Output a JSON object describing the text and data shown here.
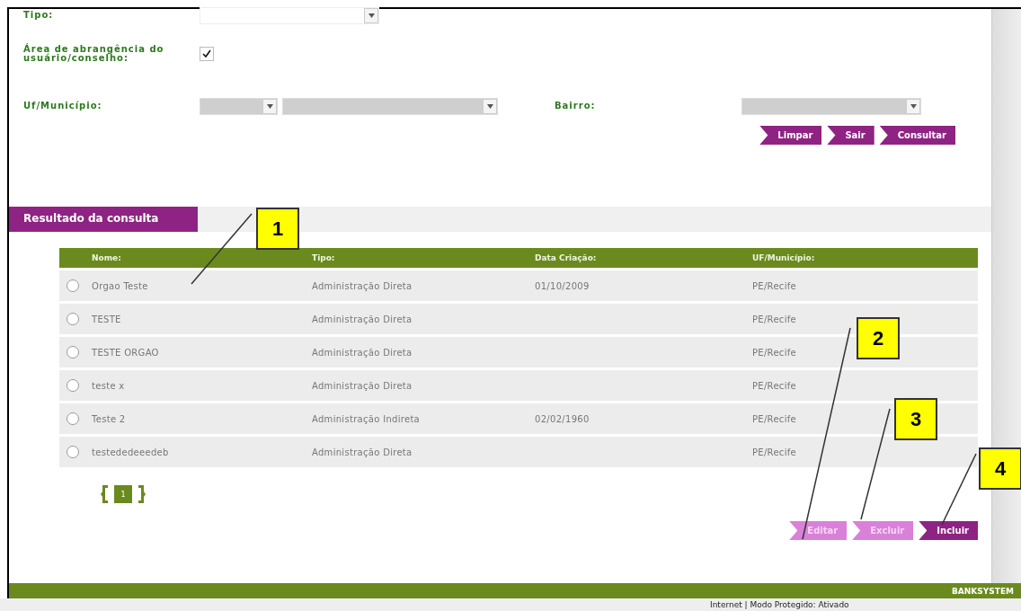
{
  "form": {
    "tipo": {
      "label": "Tipo:"
    },
    "area": {
      "label": "Área de abrangência do usuário/conselho:",
      "checked": true
    },
    "uf_municipio": {
      "label": "Uf/Município:"
    },
    "bairro": {
      "label": "Bairro:"
    },
    "buttons": [
      {
        "label": "Limpar",
        "disabled": false
      },
      {
        "label": "Sair",
        "disabled": false
      },
      {
        "label": "Consultar",
        "disabled": false
      }
    ]
  },
  "results": {
    "title": "Resultado da consulta",
    "columns": [
      "Nome:",
      "Tipo:",
      "Data Criação:",
      "UF/Município:"
    ],
    "rows": [
      {
        "selected": false,
        "cells": [
          "Orgao Teste",
          "Administração Direta",
          "01/10/2009",
          "PE/Recife"
        ]
      },
      {
        "selected": false,
        "cells": [
          "TESTE",
          "Administração Direta",
          "",
          "PE/Recife"
        ]
      },
      {
        "selected": false,
        "cells": [
          "TESTE ORGAO",
          "Administração Direta",
          "",
          "PE/Recife"
        ]
      },
      {
        "selected": false,
        "cells": [
          "teste x",
          "Administração Direta",
          "",
          "PE/Recife"
        ]
      },
      {
        "selected": false,
        "cells": [
          "Teste 2",
          "Administração Indireta",
          "02/02/1960",
          "PE/Recife"
        ]
      },
      {
        "selected": false,
        "cells": [
          "testededeeedeb",
          "Administração Direta",
          "",
          "PE/Recife"
        ]
      }
    ],
    "pages": [
      {
        "label": "1",
        "selected": true
      }
    ],
    "buttons": [
      {
        "label": "Editar",
        "disabled": true
      },
      {
        "label": "Excluir",
        "disabled": true
      },
      {
        "label": "Incluir",
        "disabled": false
      }
    ]
  },
  "footer": {
    "brand": "BANKSYSTEM"
  },
  "status_bar": {
    "text": "Internet | Modo Protegido: Ativado"
  },
  "callouts": [
    "1",
    "2",
    "3",
    "4"
  ]
}
